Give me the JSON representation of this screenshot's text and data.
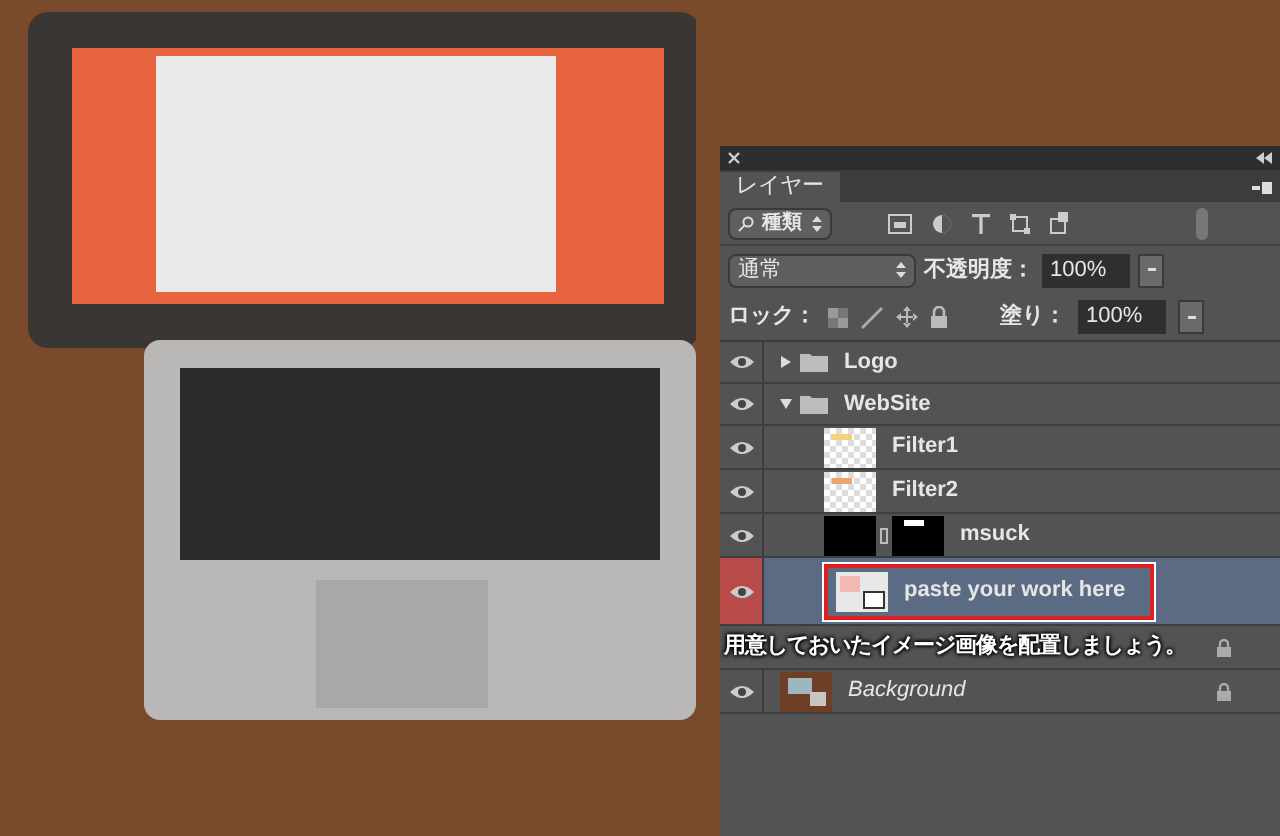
{
  "panel": {
    "tab": "レイヤー",
    "filter": {
      "value": "種類"
    },
    "blend_mode": {
      "value": "通常"
    },
    "opacity": {
      "label": "不透明度：",
      "value": "100%"
    },
    "lock": {
      "label": "ロック："
    },
    "fill": {
      "label": "塗り：",
      "value": "100%"
    },
    "layers": [
      {
        "kind": "group",
        "name": "Logo",
        "visible": true,
        "expanded": false,
        "selected": false
      },
      {
        "kind": "group",
        "name": "WebSite",
        "visible": true,
        "expanded": true,
        "selected": false,
        "children": [
          {
            "kind": "layer",
            "name": "Filter1",
            "visible": true,
            "selected": false,
            "color": "#f5d27a"
          },
          {
            "kind": "layer",
            "name": "Filter2",
            "visible": true,
            "selected": false,
            "color": "#eea36a"
          },
          {
            "kind": "masked",
            "name": "msuck",
            "visible": true,
            "selected": false
          },
          {
            "kind": "smart",
            "name": "paste your work here",
            "visible": true,
            "selected": true
          }
        ]
      },
      {
        "kind": "layer",
        "selected": false,
        "locked": true
      },
      {
        "kind": "background",
        "name": "Background",
        "visible": true,
        "selected": false,
        "locked": true
      }
    ]
  },
  "caption": "用意しておいたイメージ画像を配置しましょう。"
}
